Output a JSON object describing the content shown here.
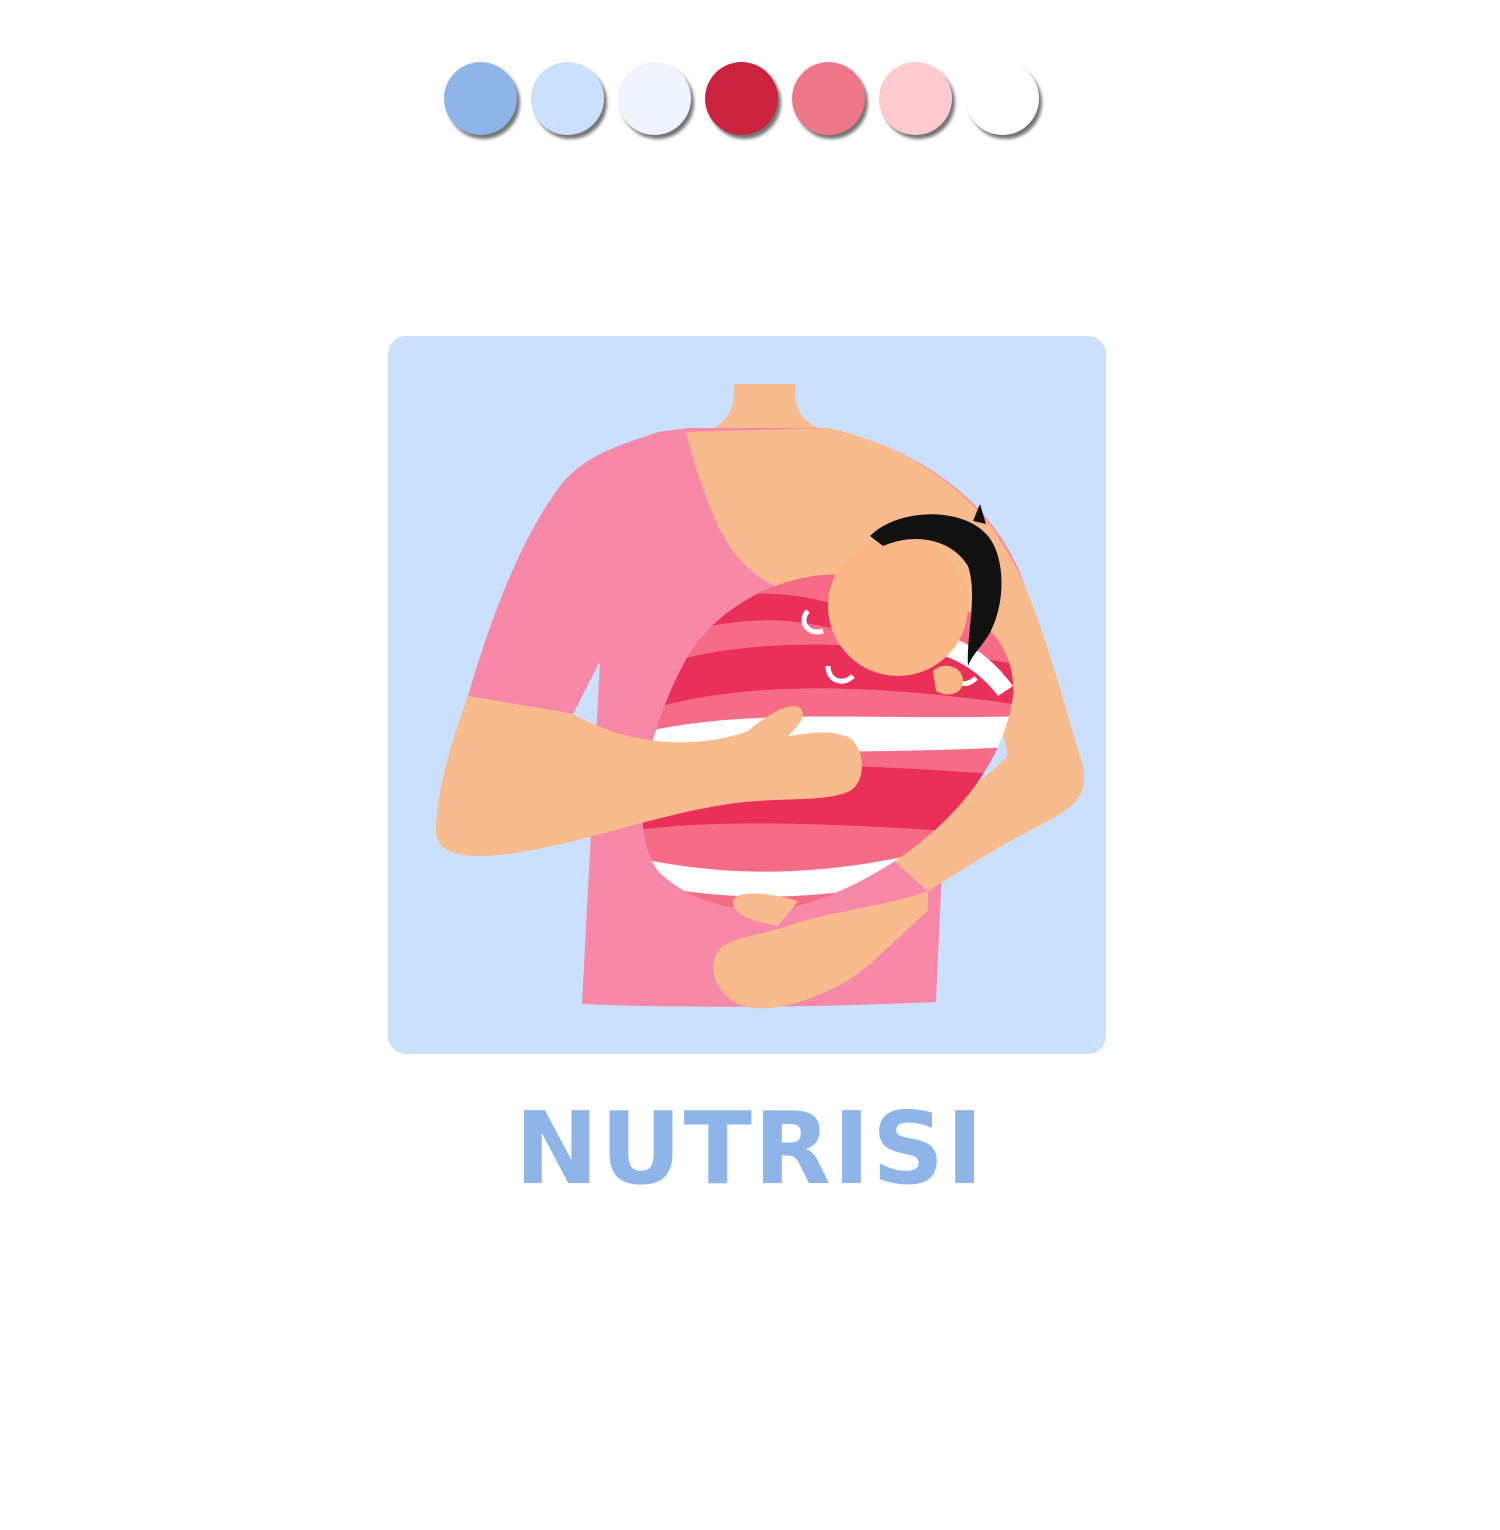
{
  "palette": {
    "swatches": [
      {
        "name": "soft-blue",
        "color": "#8fb4e8"
      },
      {
        "name": "light-blue",
        "color": "#cbe0fd"
      },
      {
        "name": "pale-blue",
        "color": "#eef3fc"
      },
      {
        "name": "crimson",
        "color": "#cb233e"
      },
      {
        "name": "rose",
        "color": "#ee7689"
      },
      {
        "name": "blush",
        "color": "#fecbd0"
      },
      {
        "name": "white",
        "color": "#ffffff"
      }
    ]
  },
  "illustration": {
    "subject": "mother-holding-baby-icon",
    "colors": {
      "background": "#cbe0fd",
      "shirt": "#f788a8",
      "skin": "#f7bb8d",
      "baby_skin": "#fbb886",
      "hair": "#111111",
      "wrap_dark": "#ea2f58",
      "wrap_mid": "#f66b85",
      "wrap_light": "#ffffff"
    }
  },
  "title": {
    "text": "NUTRISI",
    "color": "#8fb4e8"
  }
}
